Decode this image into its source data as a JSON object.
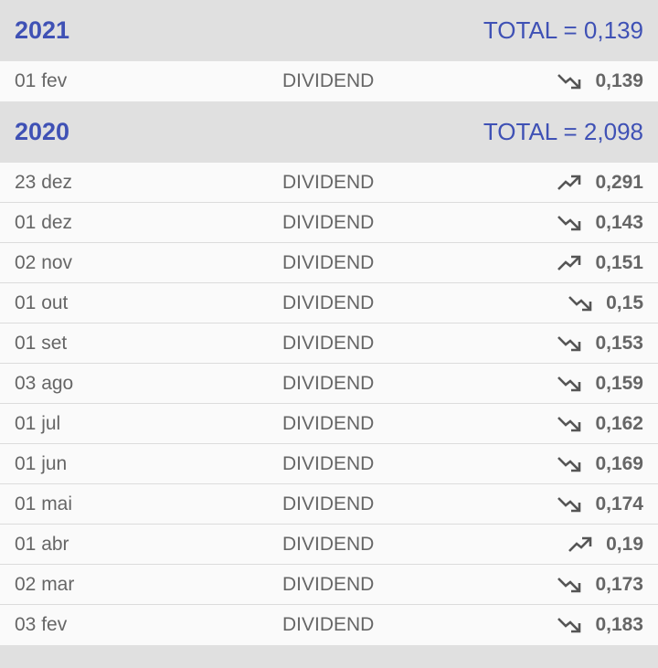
{
  "groups": [
    {
      "year": "2021",
      "total": "TOTAL = 0,139",
      "rows": [
        {
          "date": "01 fev",
          "type": "DIVIDEND",
          "trend": "trending-down-icon",
          "value": "0,139"
        }
      ]
    },
    {
      "year": "2020",
      "total": "TOTAL = 2,098",
      "rows": [
        {
          "date": "23 dez",
          "type": "DIVIDEND",
          "trend": "trending-up-icon",
          "value": "0,291"
        },
        {
          "date": "01 dez",
          "type": "DIVIDEND",
          "trend": "trending-down-icon",
          "value": "0,143"
        },
        {
          "date": "02 nov",
          "type": "DIVIDEND",
          "trend": "trending-up-icon",
          "value": "0,151"
        },
        {
          "date": "01 out",
          "type": "DIVIDEND",
          "trend": "trending-down-icon",
          "value": "0,15"
        },
        {
          "date": "01 set",
          "type": "DIVIDEND",
          "trend": "trending-down-icon",
          "value": "0,153"
        },
        {
          "date": "03 ago",
          "type": "DIVIDEND",
          "trend": "trending-down-icon",
          "value": "0,159"
        },
        {
          "date": "01 jul",
          "type": "DIVIDEND",
          "trend": "trending-down-icon",
          "value": "0,162"
        },
        {
          "date": "01 jun",
          "type": "DIVIDEND",
          "trend": "trending-down-icon",
          "value": "0,169"
        },
        {
          "date": "01 mai",
          "type": "DIVIDEND",
          "trend": "trending-down-icon",
          "value": "0,174"
        },
        {
          "date": "01 abr",
          "type": "DIVIDEND",
          "trend": "trending-up-icon",
          "value": "0,19"
        },
        {
          "date": "02 mar",
          "type": "DIVIDEND",
          "trend": "trending-down-icon",
          "value": "0,173"
        },
        {
          "date": "03 fev",
          "type": "DIVIDEND",
          "trend": "trending-down-icon",
          "value": "0,183"
        }
      ]
    }
  ],
  "colors": {
    "accent": "#3f51b5",
    "header_bg": "#e0e0e0",
    "row_bg": "#fafafa",
    "text": "#666666"
  }
}
